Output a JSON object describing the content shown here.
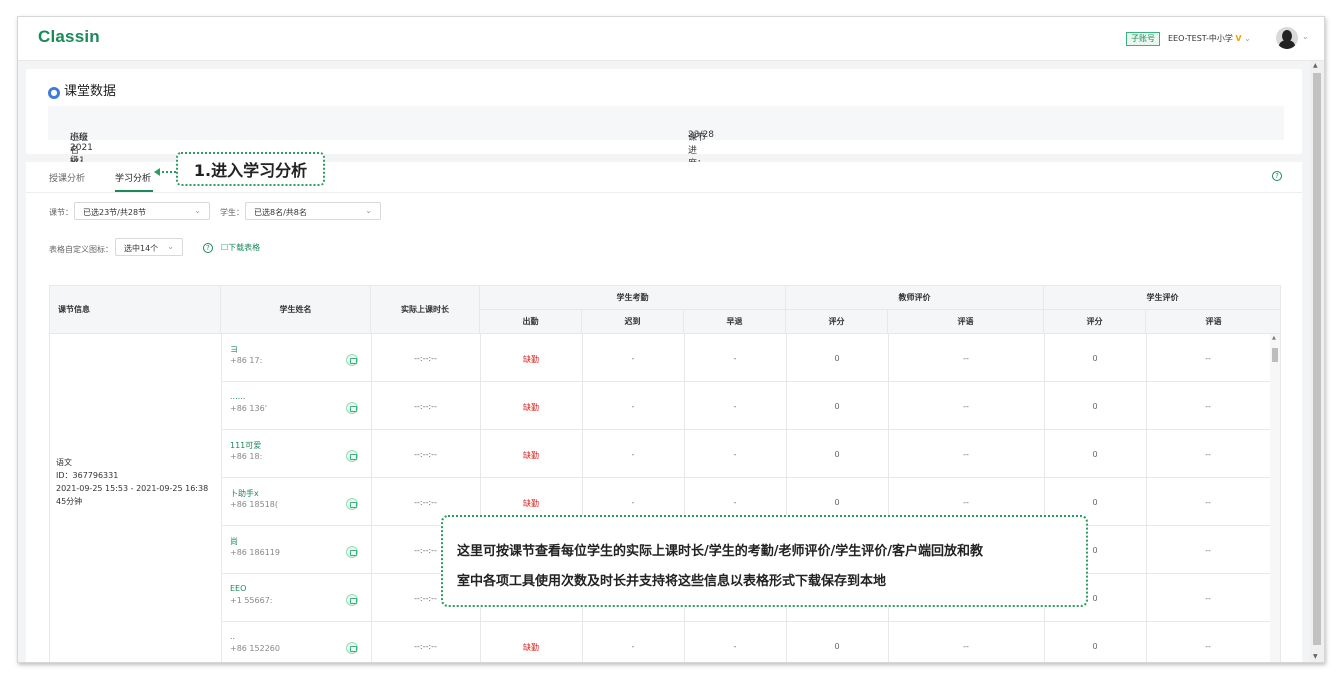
{
  "app": {
    "logo": "Classin"
  },
  "header": {
    "sub_account_badge": "子账号",
    "account_name": "EEO-TEST-中小学",
    "vip_mark": "V",
    "caret": "⌄"
  },
  "summary": {
    "title": "课堂数据",
    "class_name_label": "班级名称：",
    "class_name": "小班2021级1班",
    "progress_label": "课节进度：",
    "progress": "23/28"
  },
  "tabs": [
    {
      "label": "授课分析"
    },
    {
      "label": "学习分析"
    }
  ],
  "filters": {
    "lesson_label": "课节：",
    "lesson_value": "已选23节/共28节",
    "student_label": "学生：",
    "student_value": "已选8名/共8名",
    "metrics_label": "表格自定义图标：",
    "metrics_value": "选中14个",
    "download_label": "下载表格"
  },
  "table": {
    "headers": {
      "lesson_info": "课节信息",
      "student_name": "学生姓名",
      "actual_duration": "实际上课时长",
      "attendance_group": "学生考勤",
      "attendance": "出勤",
      "late": "迟到",
      "early_leave": "早退",
      "teacher_eval_group": "教师评价",
      "teacher_score": "评分",
      "teacher_comment": "评语",
      "student_eval_group": "学生评价",
      "student_score": "评分",
      "student_comment": "评语"
    },
    "lesson": {
      "subject": "语文",
      "id": "ID：367796331",
      "time": "2021-09-25 15:53 - 2021-09-25 16:38",
      "duration": "45分钟"
    },
    "rows": [
      {
        "name": "ヨ",
        "phone": "+86 17:",
        "duration": "--:--:--",
        "attendance": "缺勤",
        "late": "-",
        "early": "-",
        "t_score": "0",
        "t_comment": "--",
        "s_score": "0",
        "s_comment": "--"
      },
      {
        "name": "......",
        "phone": "+86 136'",
        "duration": "--:--:--",
        "attendance": "缺勤",
        "late": "-",
        "early": "-",
        "t_score": "0",
        "t_comment": "--",
        "s_score": "0",
        "s_comment": "--"
      },
      {
        "name": "111可爱",
        "phone": "+86 18:",
        "duration": "--:--:--",
        "attendance": "缺勤",
        "late": "-",
        "early": "-",
        "t_score": "0",
        "t_comment": "--",
        "s_score": "0",
        "s_comment": "--"
      },
      {
        "name": "卜助手x",
        "phone": "+86 18518(",
        "duration": "--:--:--",
        "attendance": "缺勤",
        "late": "-",
        "early": "-",
        "t_score": "0",
        "t_comment": "--",
        "s_score": "0",
        "s_comment": "--"
      },
      {
        "name": "尚",
        "phone": "+86 186119",
        "duration": "--:--:--",
        "attendance": "缺勤",
        "late": "-",
        "early": "-",
        "t_score": "0",
        "t_comment": "--",
        "s_score": "0",
        "s_comment": "--"
      },
      {
        "name": "EEO",
        "phone": "+1 55667:",
        "duration": "--:--:--",
        "attendance": "缺勤",
        "late": "-",
        "early": "-",
        "t_score": "0",
        "t_comment": "--",
        "s_score": "0",
        "s_comment": "--"
      },
      {
        "name": "..",
        "phone": "+86 152260",
        "duration": "--:--:--",
        "attendance": "缺勤",
        "late": "-",
        "early": "-",
        "t_score": "0",
        "t_comment": "--",
        "s_score": "0",
        "s_comment": "--"
      }
    ]
  },
  "callouts": {
    "step1": "1.进入学习分析",
    "note_line1": "这里可按课节查看每位学生的实际上课时长/学生的考勤/老师评价/学生评价/客户端回放和教",
    "note_line2": "室中各项工具使用次数及时长并支持将这些信息以表格形式下载保存到本地"
  },
  "colors": {
    "brand": "#1b8a5a",
    "absent": "#e02020"
  }
}
